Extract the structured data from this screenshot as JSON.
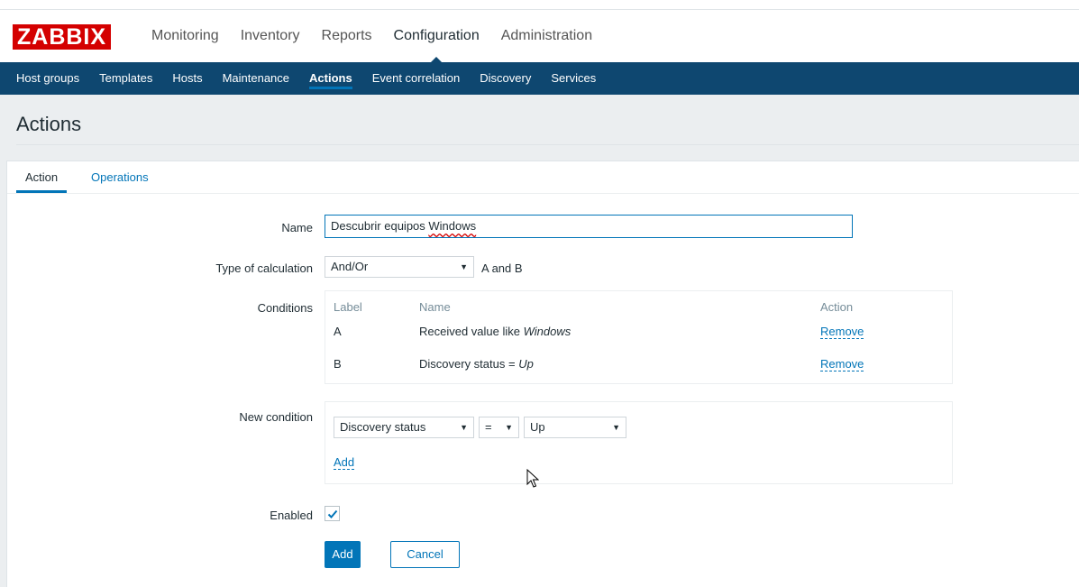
{
  "logo": "ZABBIX",
  "main_nav": [
    "Monitoring",
    "Inventory",
    "Reports",
    "Configuration",
    "Administration"
  ],
  "main_nav_active": "Configuration",
  "sub_nav": [
    "Host groups",
    "Templates",
    "Hosts",
    "Maintenance",
    "Actions",
    "Event correlation",
    "Discovery",
    "Services"
  ],
  "sub_nav_active": "Actions",
  "page_title": "Actions",
  "tabs": [
    "Action",
    "Operations"
  ],
  "tab_active": "Action",
  "form": {
    "name_label": "Name",
    "name_value_prefix": "Descubrir equipos ",
    "name_value_word": "Windows",
    "calc_label": "Type of calculation",
    "calc_value": "And/Or",
    "calc_expression": "A and B",
    "conditions_label": "Conditions",
    "conditions_headers": {
      "label": "Label",
      "name": "Name",
      "action": "Action"
    },
    "conditions": [
      {
        "label": "A",
        "name_prefix": "Received value like ",
        "name_value": "Windows",
        "action": "Remove"
      },
      {
        "label": "B",
        "name_prefix": "Discovery status = ",
        "name_value": "Up",
        "action": "Remove"
      }
    ],
    "new_condition_label": "New condition",
    "new_condition_type": "Discovery status",
    "new_condition_operator": "=",
    "new_condition_value": "Up",
    "new_condition_add": "Add",
    "enabled_label": "Enabled",
    "enabled": true,
    "add_button": "Add",
    "cancel_button": "Cancel"
  },
  "colors": {
    "brand": "#d40000",
    "nav": "#0e4770",
    "accent": "#0275b8"
  }
}
